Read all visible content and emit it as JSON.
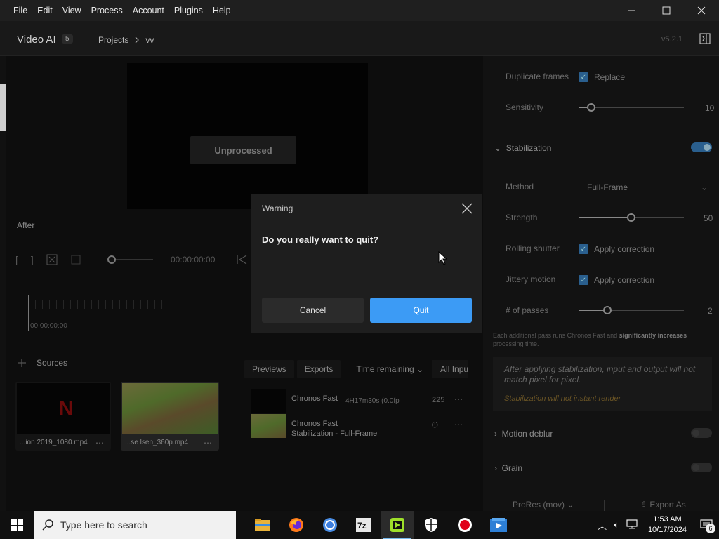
{
  "menubar": {
    "items": [
      "File",
      "Edit",
      "View",
      "Process",
      "Account",
      "Plugins",
      "Help"
    ]
  },
  "header": {
    "app_name": "Video AI",
    "badge": "5",
    "breadcrumb_projects": "Projects",
    "breadcrumb_project": "vv",
    "version": "v5.2.1"
  },
  "preview": {
    "status": "Unprocessed",
    "after_label": "After",
    "timecode": "00:00:00:00",
    "timeline_timecode": "00:00:00:00"
  },
  "sources": {
    "label": "Sources",
    "files": [
      {
        "name": "...ion 2019_1080.mp4"
      },
      {
        "name": "...se lsen_360p.mp4"
      }
    ]
  },
  "queue": {
    "tabs": [
      "Previews",
      "Exports"
    ],
    "sort": "Time remaining",
    "filter": "All Inpu",
    "jobs": [
      {
        "line1": "Chronos Fast",
        "meta": "4H17m30s  (0.0fp",
        "badge": "225"
      },
      {
        "line1": "Chronos Fast",
        "line2": "Stabilization - Full-Frame"
      }
    ]
  },
  "settings": {
    "duplicate_frames_label": "Duplicate frames",
    "duplicate_frames_value": "Replace",
    "sensitivity_label": "Sensitivity",
    "sensitivity_value": "10",
    "sensitivity_fraction": 0.12,
    "stabilization_label": "Stabilization",
    "stabilization_on": true,
    "method_label": "Method",
    "method_value": "Full-Frame",
    "strength_label": "Strength",
    "strength_value": "50",
    "strength_fraction": 0.5,
    "rolling_shutter_label": "Rolling shutter",
    "rolling_shutter_value": "Apply correction",
    "jittery_motion_label": "Jittery motion",
    "jittery_motion_value": "Apply correction",
    "passes_label": "# of passes",
    "passes_value": "2",
    "passes_fraction": 0.27,
    "hint_prefix": "Each additional pass runs Chronos Fast and ",
    "hint_bold": "significantly increases",
    "hint_suffix": " processing time.",
    "note_text": "After applying stabilization, input and output will not match pixel for pixel.",
    "note_warning": "Stabilization will not instant render",
    "motion_deblur_label": "Motion deblur",
    "grain_label": "Grain",
    "export_format": "ProRes (mov)",
    "export_button": "Export As"
  },
  "dialog": {
    "title": "Warning",
    "message": "Do you really want to quit?",
    "cancel": "Cancel",
    "quit": "Quit"
  },
  "taskbar": {
    "search_placeholder": "Type here to search",
    "apps": [
      "file-explorer",
      "firefox",
      "chrome",
      "7zip",
      "video-ai",
      "windows-security",
      "recorder",
      "media-app"
    ],
    "time": "1:53 AM",
    "date": "10/17/2024",
    "notification_count": "6"
  },
  "colors": {
    "accent": "#3c9bf5",
    "dialog_bg": "#1e1e1e"
  }
}
